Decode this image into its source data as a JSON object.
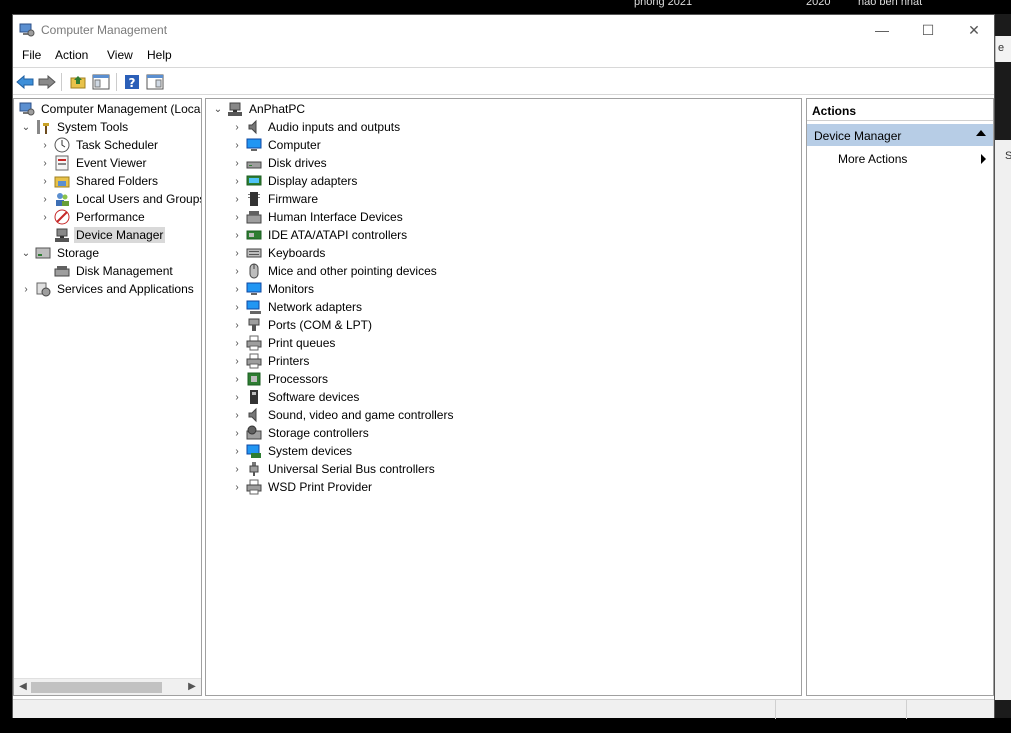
{
  "background": {
    "texts": [
      "phòng 2021",
      "2020",
      "hao bền nhất"
    ],
    "side_label_top": "e",
    "side_label_mid": "S"
  },
  "window": {
    "title": "Computer Management",
    "controls": {
      "minimize": "—",
      "maximize": "☐",
      "close": "✕"
    }
  },
  "menu": [
    "File",
    "Action",
    "View",
    "Help"
  ],
  "toolbar": {
    "buttons": [
      "back-arrow-icon",
      "forward-arrow-icon",
      "up-folder-icon",
      "show-hide-tree-icon",
      "help-icon",
      "show-hide-action-pane-icon"
    ]
  },
  "left_tree": [
    {
      "label": "Computer Management (Local",
      "level": 0,
      "expander": "",
      "icon": "computer-management-icon"
    },
    {
      "label": "System Tools",
      "level": 1,
      "expander": "⌄",
      "icon": "system-tools-icon"
    },
    {
      "label": "Task Scheduler",
      "level": 2,
      "expander": "›",
      "icon": "clock-icon"
    },
    {
      "label": "Event Viewer",
      "level": 2,
      "expander": "›",
      "icon": "event-viewer-icon"
    },
    {
      "label": "Shared Folders",
      "level": 2,
      "expander": "›",
      "icon": "shared-folders-icon"
    },
    {
      "label": "Local Users and Groups",
      "level": 2,
      "expander": "›",
      "icon": "users-icon"
    },
    {
      "label": "Performance",
      "level": 2,
      "expander": "›",
      "icon": "performance-icon"
    },
    {
      "label": "Device Manager",
      "level": 2,
      "expander": "",
      "icon": "device-manager-icon",
      "selected": true
    },
    {
      "label": "Storage",
      "level": 1,
      "expander": "⌄",
      "icon": "storage-icon"
    },
    {
      "label": "Disk Management",
      "level": 2,
      "expander": "",
      "icon": "disk-management-icon"
    },
    {
      "label": "Services and Applications",
      "level": 1,
      "expander": "›",
      "icon": "services-icon"
    }
  ],
  "device_tree": {
    "root": "AnPhatPC",
    "items": [
      {
        "label": "Audio inputs and outputs",
        "icon": "speaker-icon"
      },
      {
        "label": "Computer",
        "icon": "computer-icon"
      },
      {
        "label": "Disk drives",
        "icon": "disk-drive-icon"
      },
      {
        "label": "Display adapters",
        "icon": "display-adapter-icon"
      },
      {
        "label": "Firmware",
        "icon": "firmware-icon"
      },
      {
        "label": "Human Interface Devices",
        "icon": "hid-icon"
      },
      {
        "label": "IDE ATA/ATAPI controllers",
        "icon": "ide-controller-icon"
      },
      {
        "label": "Keyboards",
        "icon": "keyboard-icon"
      },
      {
        "label": "Mice and other pointing devices",
        "icon": "mouse-icon"
      },
      {
        "label": "Monitors",
        "icon": "monitor-icon"
      },
      {
        "label": "Network adapters",
        "icon": "network-adapter-icon"
      },
      {
        "label": "Ports (COM & LPT)",
        "icon": "port-icon"
      },
      {
        "label": "Print queues",
        "icon": "print-queue-icon"
      },
      {
        "label": "Printers",
        "icon": "printer-icon"
      },
      {
        "label": "Processors",
        "icon": "processor-icon"
      },
      {
        "label": "Software devices",
        "icon": "software-device-icon"
      },
      {
        "label": "Sound, video and game controllers",
        "icon": "sound-controller-icon"
      },
      {
        "label": "Storage controllers",
        "icon": "storage-controller-icon"
      },
      {
        "label": "System devices",
        "icon": "system-device-icon"
      },
      {
        "label": "Universal Serial Bus controllers",
        "icon": "usb-icon"
      },
      {
        "label": "WSD Print Provider",
        "icon": "wsd-printer-icon"
      }
    ]
  },
  "actions": {
    "header": "Actions",
    "section": "Device Manager",
    "item": "More Actions"
  },
  "colors": {
    "accent": "#b7cde6",
    "selection": "#d9d9d9"
  }
}
